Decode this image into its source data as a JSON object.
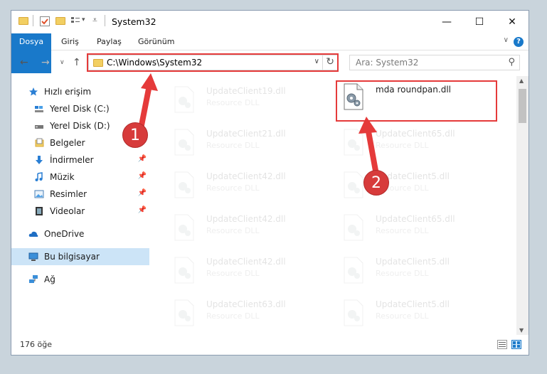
{
  "window": {
    "title": "System32",
    "qat_dropdown": "▾",
    "minimize": "—",
    "maximize": "☐",
    "close": "✕"
  },
  "ribbon": {
    "tabs": [
      "Dosya",
      "Giriş",
      "Paylaş",
      "Görünüm"
    ],
    "help": "?",
    "collapse": "∨"
  },
  "address_bar": {
    "back": "←",
    "forward": "→",
    "up": "↑",
    "path": "C:\\Windows\\System32",
    "dropdown": "∨",
    "refresh": "↻",
    "search_placeholder": "Ara: System32",
    "search_icon": "⚲"
  },
  "nav_pane": {
    "items": [
      {
        "label": "Hızlı erişim",
        "icon": "star-icon",
        "pinned": false
      },
      {
        "label": "Yerel Disk (C:)",
        "icon": "drive-icon",
        "pinned": false
      },
      {
        "label": "Yerel Disk (D:)",
        "icon": "drive-icon",
        "pinned": false
      },
      {
        "label": "Belgeler",
        "icon": "documents-icon",
        "pinned": false
      },
      {
        "label": "İndirmeler",
        "icon": "download-icon",
        "pinned": true
      },
      {
        "label": "Müzik",
        "icon": "music-icon",
        "pinned": true
      },
      {
        "label": "Resimler",
        "icon": "pictures-icon",
        "pinned": true
      },
      {
        "label": "Videolar",
        "icon": "videos-icon",
        "pinned": true
      },
      {
        "label": "OneDrive",
        "icon": "cloud-icon",
        "pinned": false
      },
      {
        "label": "Bu bilgisayar",
        "icon": "computer-icon",
        "pinned": false,
        "selected": true
      },
      {
        "label": "Ağ",
        "icon": "network-icon",
        "pinned": false
      }
    ],
    "pin_glyph": "📌"
  },
  "files": {
    "highlighted": {
      "name": "mda roundpan.dll",
      "type": ""
    },
    "left_column": [
      {
        "name": "UpdateClient19.dll",
        "type": "Resource DLL"
      },
      {
        "name": "UpdateClient21.dll",
        "type": "Resource DLL"
      },
      {
        "name": "UpdateClient42.dll",
        "type": "Resource DLL"
      },
      {
        "name": "UpdateClient42.dll",
        "type": "Resource DLL"
      },
      {
        "name": "UpdateClient42.dll",
        "type": "Resource DLL"
      },
      {
        "name": "UpdateClient63.dll",
        "type": "Resource DLL"
      }
    ],
    "right_column": [
      {
        "name": "UpdateClient65.dll",
        "type": "Resource DLL"
      },
      {
        "name": "UpdateClient5.dll",
        "type": "Resource DLL"
      },
      {
        "name": "UpdateClient65.dll",
        "type": "Resource DLL"
      },
      {
        "name": "UpdateClient5.dll",
        "type": "Resource DLL"
      },
      {
        "name": "UpdateClient5.dll",
        "type": "Resource DLL"
      }
    ]
  },
  "status_bar": {
    "item_count": "176 öğe"
  },
  "annotations": {
    "step1": "1",
    "step2": "2",
    "color": "#e53a3a"
  },
  "colors": {
    "accent": "#1979ca",
    "selection": "#cce4f7"
  }
}
